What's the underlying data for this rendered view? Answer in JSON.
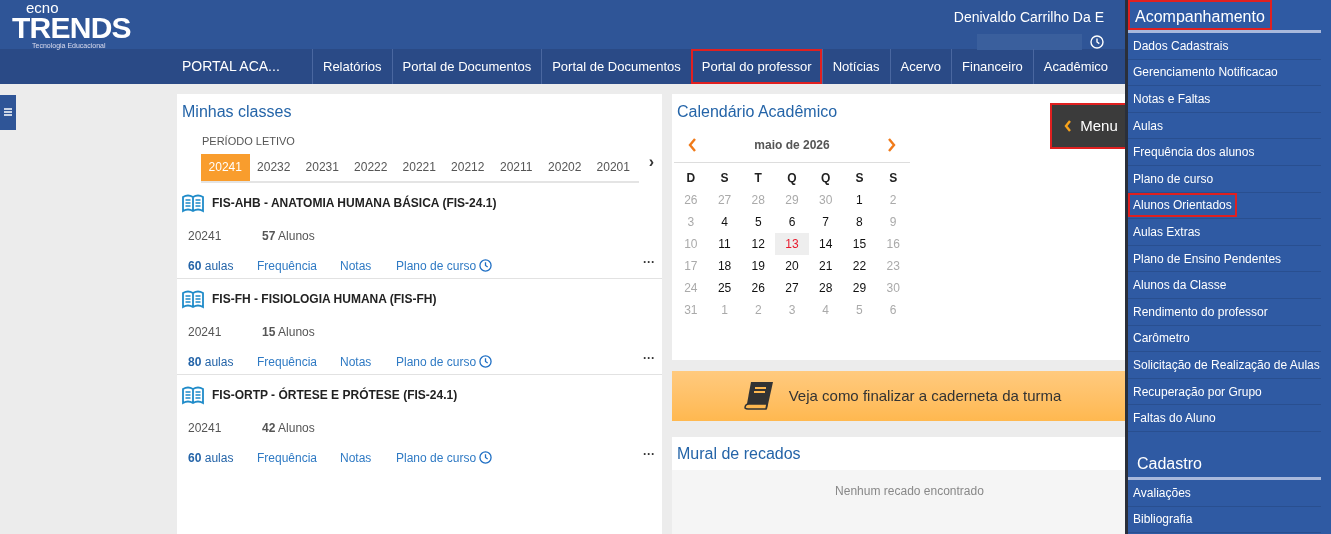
{
  "header": {
    "logo_top": "ecno",
    "logo_main": "TRENDS",
    "logo_sub": "Tecnologia Educacional",
    "user_name": "Denivaldo Carrilho Da E"
  },
  "nav": {
    "brand": "PORTAL ACA...",
    "tabs": [
      {
        "label": "Relatórios",
        "highlighted": false
      },
      {
        "label": "Portal de Documentos",
        "highlighted": false
      },
      {
        "label": "Portal de Documentos",
        "highlighted": false
      },
      {
        "label": "Portal do professor",
        "highlighted": true
      },
      {
        "label": "Notícias",
        "highlighted": false
      },
      {
        "label": "Acervo",
        "highlighted": false
      },
      {
        "label": "Financeiro",
        "highlighted": false
      },
      {
        "label": "Acadêmico",
        "highlighted": false
      }
    ]
  },
  "classes": {
    "title": "Minhas classes",
    "period_label": "PERÍODO LETIVO",
    "periods": [
      {
        "label": "20241",
        "selected": true
      },
      {
        "label": "20232",
        "selected": false
      },
      {
        "label": "20231",
        "selected": false
      },
      {
        "label": "20222",
        "selected": false
      },
      {
        "label": "20221",
        "selected": false
      },
      {
        "label": "20212",
        "selected": false
      },
      {
        "label": "20211",
        "selected": false
      },
      {
        "label": "20202",
        "selected": false
      },
      {
        "label": "20201",
        "selected": false
      }
    ],
    "more": "›",
    "items": [
      {
        "name": "FIS-AHB - ANATOMIA HUMANA BÁSICA (FIS-24.1)",
        "period": "20241",
        "students_count": "57",
        "students_label": "Alunos",
        "lessons_count": "60",
        "lessons_label": "aulas",
        "links": [
          "Frequência",
          "Notas",
          "Plano de curso"
        ],
        "menu": "···"
      },
      {
        "name": "FIS-FH - FISIOLOGIA HUMANA (FIS-FH)",
        "period": "20241",
        "students_count": "15",
        "students_label": "Alunos",
        "lessons_count": "80",
        "lessons_label": "aulas",
        "links": [
          "Frequência",
          "Notas",
          "Plano de curso"
        ],
        "menu": "···"
      },
      {
        "name": "FIS-ORTP - ÓRTESE E PRÓTESE (FIS-24.1)",
        "period": "20241",
        "students_count": "42",
        "students_label": "Alunos",
        "lessons_count": "60",
        "lessons_label": "aulas",
        "links": [
          "Frequência",
          "Notas",
          "Plano de curso"
        ],
        "menu": "···"
      }
    ]
  },
  "calendar": {
    "title": "Calendário Acadêmico",
    "month": "maio de 2026",
    "weekdays": [
      "D",
      "S",
      "T",
      "Q",
      "Q",
      "S",
      "S"
    ],
    "weeks": [
      [
        {
          "day": "26",
          "muted": true,
          "today": false
        },
        {
          "day": "27",
          "muted": true,
          "today": false
        },
        {
          "day": "28",
          "muted": true,
          "today": false
        },
        {
          "day": "29",
          "muted": true,
          "today": false
        },
        {
          "day": "30",
          "muted": true,
          "today": false
        },
        {
          "day": "1",
          "muted": false,
          "today": false
        },
        {
          "day": "2",
          "muted": true,
          "today": false
        }
      ],
      [
        {
          "day": "3",
          "muted": true,
          "today": false
        },
        {
          "day": "4",
          "muted": false,
          "today": false
        },
        {
          "day": "5",
          "muted": false,
          "today": false
        },
        {
          "day": "6",
          "muted": false,
          "today": false
        },
        {
          "day": "7",
          "muted": false,
          "today": false
        },
        {
          "day": "8",
          "muted": false,
          "today": false
        },
        {
          "day": "9",
          "muted": true,
          "today": false
        }
      ],
      [
        {
          "day": "10",
          "muted": true,
          "today": false
        },
        {
          "day": "11",
          "muted": false,
          "today": false
        },
        {
          "day": "12",
          "muted": false,
          "today": false
        },
        {
          "day": "13",
          "muted": false,
          "today": true
        },
        {
          "day": "14",
          "muted": false,
          "today": false
        },
        {
          "day": "15",
          "muted": false,
          "today": false
        },
        {
          "day": "16",
          "muted": true,
          "today": false
        }
      ],
      [
        {
          "day": "17",
          "muted": true,
          "today": false
        },
        {
          "day": "18",
          "muted": false,
          "today": false
        },
        {
          "day": "19",
          "muted": false,
          "today": false
        },
        {
          "day": "20",
          "muted": false,
          "today": false
        },
        {
          "day": "21",
          "muted": false,
          "today": false
        },
        {
          "day": "22",
          "muted": false,
          "today": false
        },
        {
          "day": "23",
          "muted": true,
          "today": false
        }
      ],
      [
        {
          "day": "24",
          "muted": true,
          "today": false
        },
        {
          "day": "25",
          "muted": false,
          "today": false
        },
        {
          "day": "26",
          "muted": false,
          "today": false
        },
        {
          "day": "27",
          "muted": false,
          "today": false
        },
        {
          "day": "28",
          "muted": false,
          "today": false
        },
        {
          "day": "29",
          "muted": false,
          "today": false
        },
        {
          "day": "30",
          "muted": true,
          "today": false
        }
      ],
      [
        {
          "day": "31",
          "muted": true,
          "today": false
        },
        {
          "day": "1",
          "muted": true,
          "today": false
        },
        {
          "day": "2",
          "muted": true,
          "today": false
        },
        {
          "day": "3",
          "muted": true,
          "today": false
        },
        {
          "day": "4",
          "muted": true,
          "today": false
        },
        {
          "day": "5",
          "muted": true,
          "today": false
        },
        {
          "day": "6",
          "muted": true,
          "today": false
        }
      ]
    ]
  },
  "menu_button": {
    "label": "Menu",
    "highlighted": true
  },
  "banner": {
    "text": "Veja como finalizar a caderneta da turma"
  },
  "board": {
    "title": "Mural de recados",
    "empty": "Nenhum recado encontrado"
  },
  "sidebar": {
    "sections": [
      {
        "title": "Acompanhamento",
        "highlighted": true,
        "items": [
          {
            "label": "Dados Cadastrais",
            "highlighted": false
          },
          {
            "label": "Gerenciamento Notificacao",
            "highlighted": false
          },
          {
            "label": "Notas e Faltas",
            "highlighted": false
          },
          {
            "label": "Aulas",
            "highlighted": false
          },
          {
            "label": "Frequência dos alunos",
            "highlighted": false
          },
          {
            "label": "Plano de curso",
            "highlighted": false
          },
          {
            "label": "Alunos Orientados",
            "highlighted": true
          },
          {
            "label": "Aulas Extras",
            "highlighted": false
          },
          {
            "label": "Plano de Ensino Pendentes",
            "highlighted": false
          },
          {
            "label": "Alunos da Classe",
            "highlighted": false
          },
          {
            "label": "Rendimento do professor",
            "highlighted": false
          },
          {
            "label": "Carômetro",
            "highlighted": false
          },
          {
            "label": "Solicitação de Realização de Aulas",
            "highlighted": false
          },
          {
            "label": "Recuperação por Grupo",
            "highlighted": false
          },
          {
            "label": "Faltas do Aluno",
            "highlighted": false
          }
        ]
      },
      {
        "title": "Cadastro",
        "highlighted": false,
        "items": [
          {
            "label": "Avaliações",
            "highlighted": false
          },
          {
            "label": "Bibliografia",
            "highlighted": false
          }
        ]
      }
    ]
  }
}
